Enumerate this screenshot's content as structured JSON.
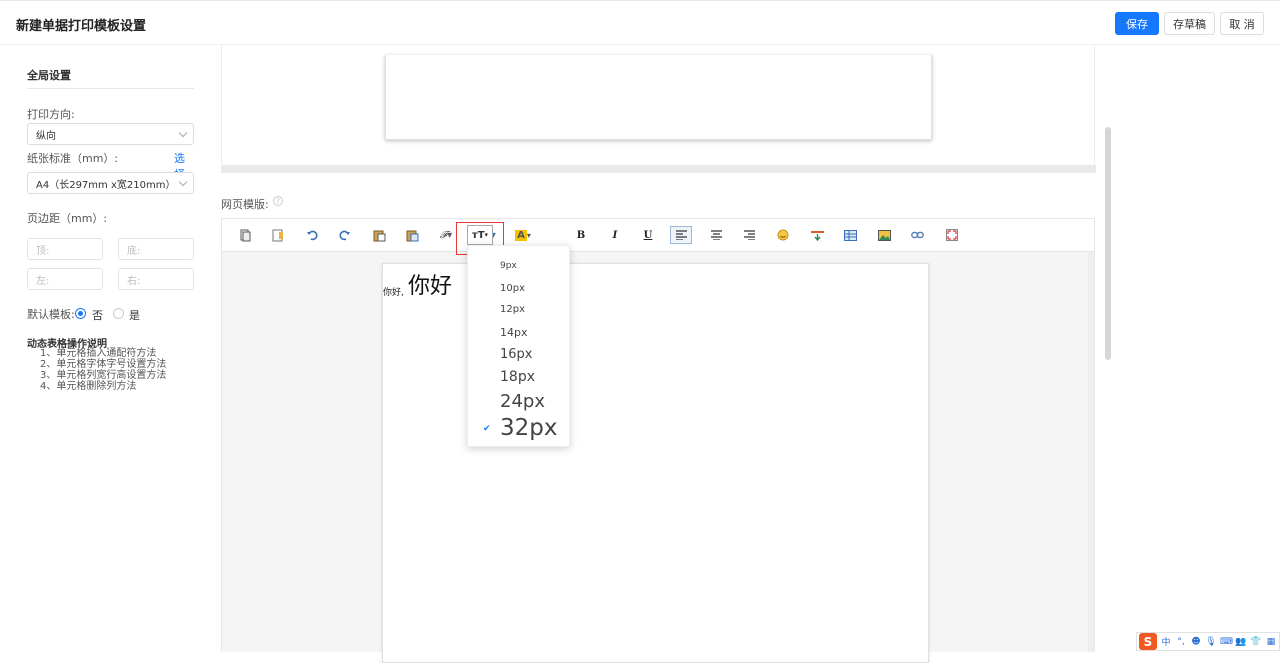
{
  "header": {
    "title": "新建单据打印模板设置",
    "save": "保存",
    "draft": "存草稿",
    "cancel": "取 消"
  },
  "sidebar": {
    "section_title": "全局设置",
    "orientation_label": "打印方向:",
    "orientation_value": "纵向",
    "paper_label": "纸张标准（mm）:",
    "paper_select_link": "选择",
    "paper_value": "A4（长297mm x宽210mm）",
    "margin_label": "页边距（mm）:",
    "margin_top": "顶:",
    "margin_bottom": "底:",
    "margin_left": "左:",
    "margin_right": "右:",
    "default_label": "默认模板:",
    "default_no": "否",
    "default_yes": "是",
    "notes_title": "动态表格操作说明",
    "notes": [
      "1、单元格插入通配符方法",
      "2、单元格字体字号设置方法",
      "3、单元格列宽行高设置方法",
      "4、单元格删除列方法"
    ]
  },
  "editor": {
    "template_label": "网页模版:",
    "help_icon": "?",
    "font_size_button": "тT",
    "content_small": "你好,",
    "content_big": "你好",
    "font_sizes": [
      "9px",
      "10px",
      "12px",
      "14px",
      "16px",
      "18px",
      "24px",
      "32px"
    ],
    "selected_font_size": "32px",
    "check_mark": "✔"
  },
  "ime": {
    "logo": "S",
    "lang": "中"
  }
}
